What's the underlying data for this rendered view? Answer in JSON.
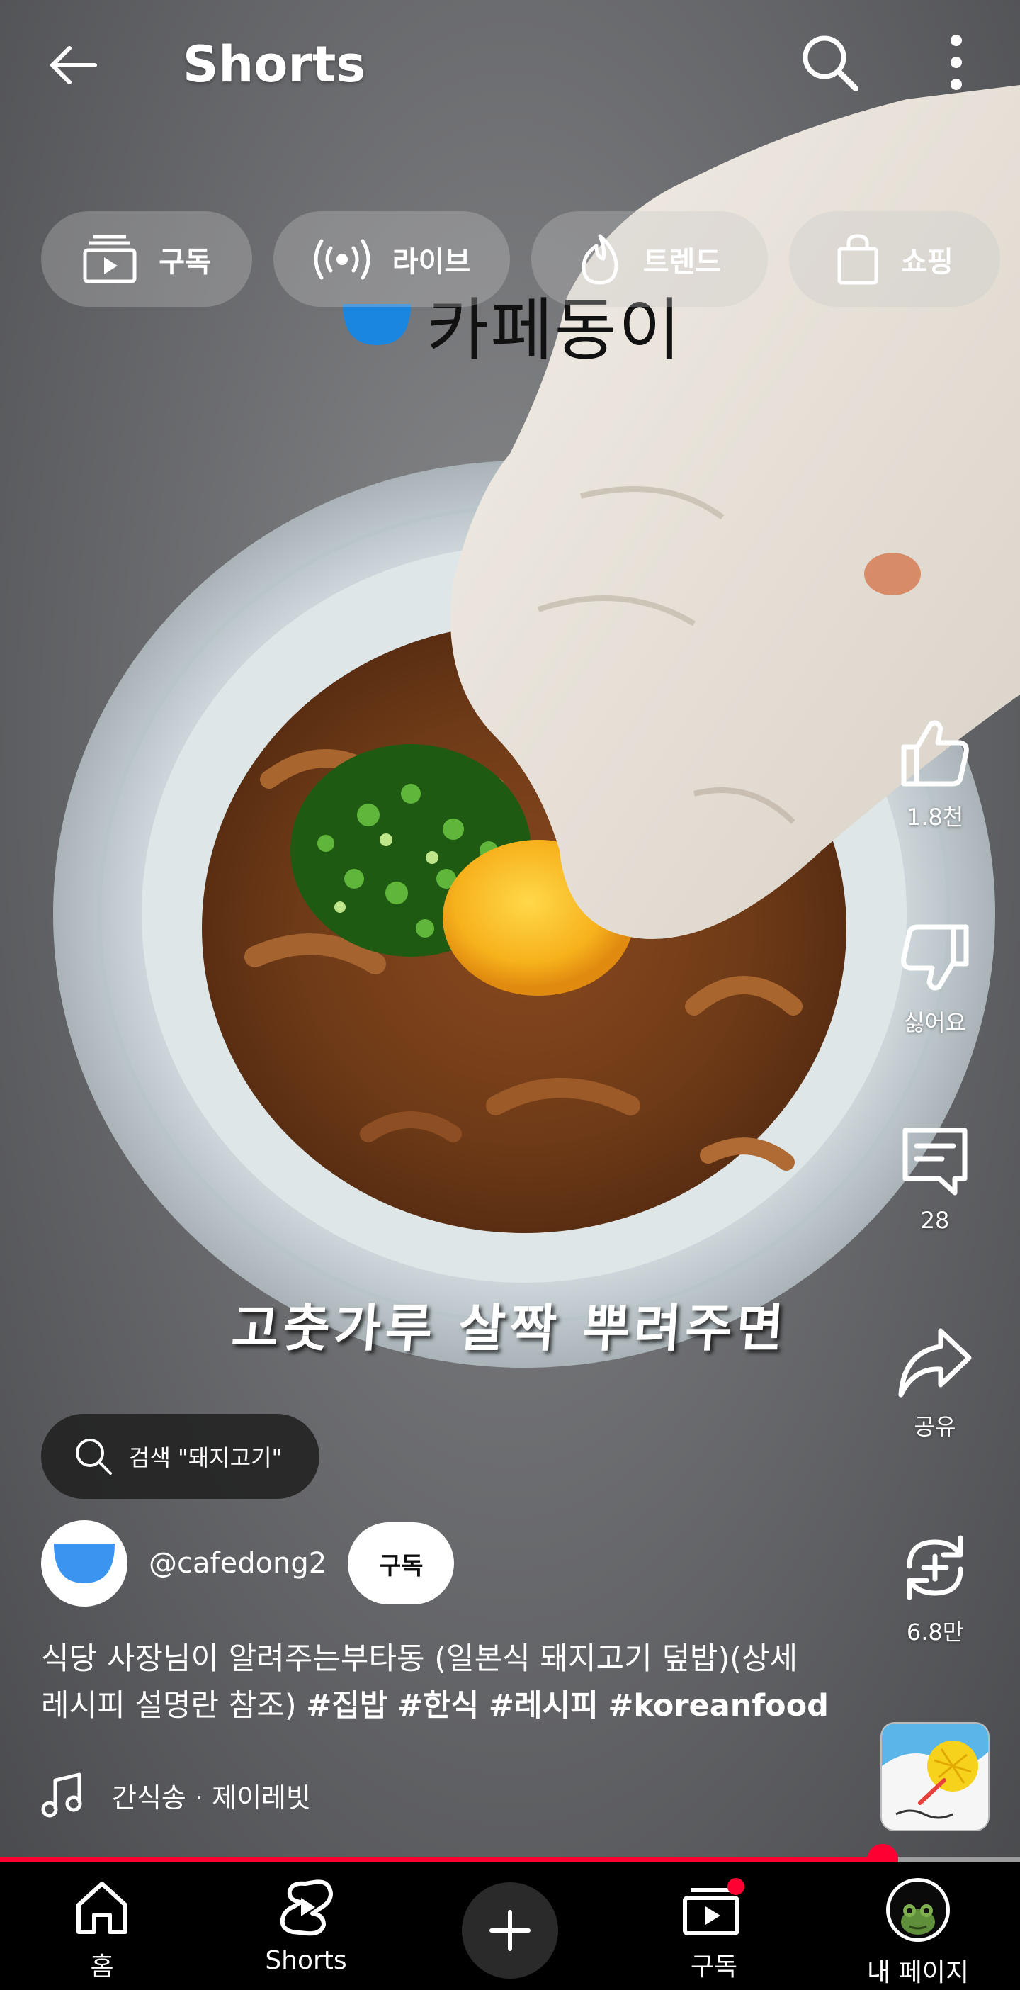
{
  "header": {
    "title": "Shorts"
  },
  "chips": [
    {
      "label": "구독",
      "icon": "subscriptions-icon"
    },
    {
      "label": "라이브",
      "icon": "live-icon"
    },
    {
      "label": "트렌드",
      "icon": "trending-flame-icon"
    },
    {
      "label": "쇼핑",
      "icon": "shopping-bag-icon"
    }
  ],
  "video": {
    "watermark": "카페동이",
    "subtitle": "고춧가루 살짝 뿌려주면"
  },
  "actions": {
    "like_count": "1.8천",
    "dislike_label": "싫어요",
    "comment_count": "28",
    "share_label": "공유",
    "remix_count": "6.8만"
  },
  "search_suggestion": "검색 \"돼지고기\"",
  "channel": {
    "handle": "@cafedong2",
    "subscribe_label": "구독"
  },
  "description": {
    "text": "식당 사장님이 알려주는부타동 (일본식 돼지고기 덮밥)(상세 레시피 설명란 참조) ",
    "hashtags": [
      "#집밥",
      "#한식",
      "#레시피",
      "#koreanfood"
    ]
  },
  "music": {
    "label": "간식송 · 제이레빗"
  },
  "progress": {
    "played_fraction": 0.865
  },
  "nav": {
    "home": "홈",
    "shorts": "Shorts",
    "subscriptions": "구독",
    "me": "내 페이지"
  },
  "colors": {
    "accent": "#ff0033",
    "watermark_blue": "#1a86e0"
  }
}
